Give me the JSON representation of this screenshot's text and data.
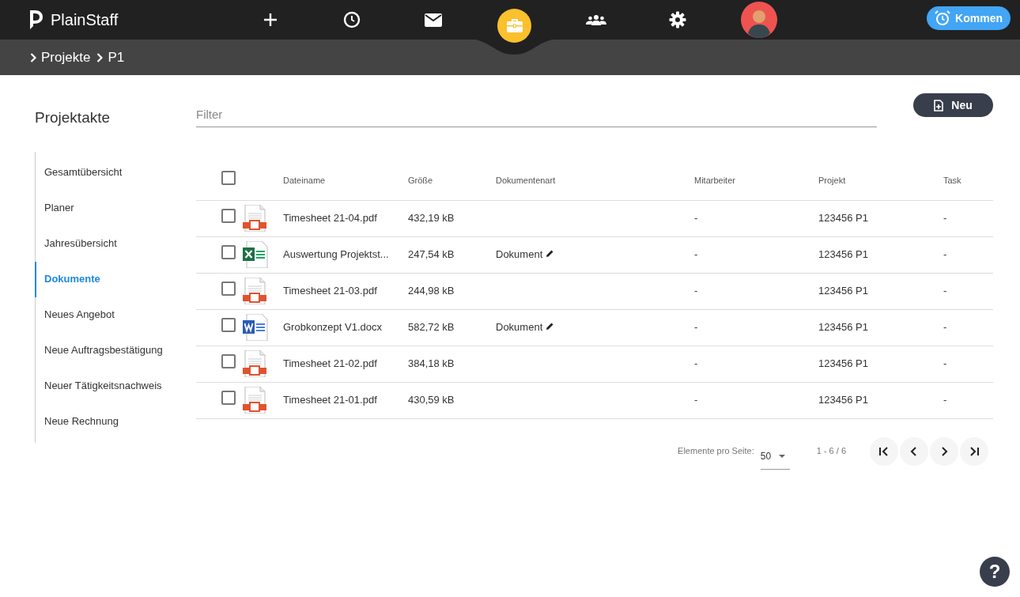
{
  "app": {
    "name": "PlainStaff"
  },
  "nav": [
    {
      "kind": "plus",
      "selected": false
    },
    {
      "kind": "clock",
      "selected": false
    },
    {
      "kind": "mail",
      "selected": false
    },
    {
      "kind": "briefcase",
      "selected": true
    },
    {
      "kind": "team",
      "selected": false
    },
    {
      "kind": "gear",
      "selected": false
    },
    {
      "kind": "avatar",
      "selected": false
    }
  ],
  "clock_button": {
    "label": "Kommen"
  },
  "breadcrumb": [
    "Projekte",
    "P1"
  ],
  "sidebar": {
    "title": "Projektakte",
    "items": [
      {
        "label": "Gesamtübersicht",
        "selected": false
      },
      {
        "label": "Planer",
        "selected": false
      },
      {
        "label": "Jahresübersicht",
        "selected": false
      },
      {
        "label": "Dokumente",
        "selected": true
      },
      {
        "label": "Neues Angebot",
        "selected": false
      },
      {
        "label": "Neue Auftragsbestätigung",
        "selected": false
      },
      {
        "label": "Neuer Tätigkeitsnachweis",
        "selected": false
      },
      {
        "label": "Neue Rechnung",
        "selected": false
      }
    ]
  },
  "filter": {
    "placeholder": "Filter"
  },
  "new_button": {
    "label": "Neu"
  },
  "table": {
    "select_all": {
      "checked": false
    },
    "columns": [
      "Dateiname",
      "Größe",
      "Dokumentenart",
      "Mitarbeiter",
      "Projekt",
      "Task"
    ],
    "rows": [
      {
        "kind": "pdf",
        "checked": false,
        "name": "Timesheet 21-04.pdf",
        "size": "432,19 kB",
        "doctype": "",
        "employee": "-",
        "project": "123456 P1",
        "task": "-"
      },
      {
        "kind": "excel",
        "checked": false,
        "name": "Auswertung Projektst...",
        "size": "247,54 kB",
        "doctype": "Dokument",
        "employee": "-",
        "project": "123456 P1",
        "task": "-"
      },
      {
        "kind": "pdf",
        "checked": false,
        "name": "Timesheet 21-03.pdf",
        "size": "244,98 kB",
        "doctype": "",
        "employee": "-",
        "project": "123456 P1",
        "task": "-"
      },
      {
        "kind": "word",
        "checked": false,
        "name": "Grobkonzept V1.docx",
        "size": "582,72 kB",
        "doctype": "Dokument",
        "employee": "-",
        "project": "123456 P1",
        "task": "-"
      },
      {
        "kind": "pdf",
        "checked": false,
        "name": "Timesheet 21-02.pdf",
        "size": "384,18 kB",
        "doctype": "",
        "employee": "-",
        "project": "123456 P1",
        "task": "-"
      },
      {
        "kind": "pdf",
        "checked": false,
        "name": "Timesheet 21-01.pdf",
        "size": "430,59 kB",
        "doctype": "",
        "employee": "-",
        "project": "123456 P1",
        "task": "-"
      }
    ]
  },
  "pagination": {
    "per_page_label": "Elemente pro Seite:",
    "per_page": "50",
    "range": "1 - 6 / 6"
  },
  "help_button": {
    "label": "?"
  }
}
